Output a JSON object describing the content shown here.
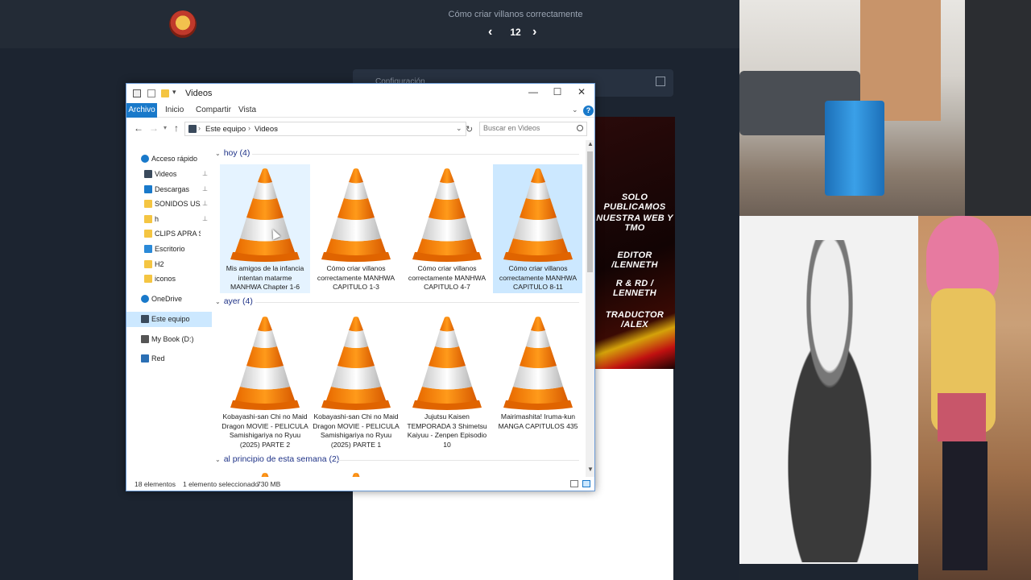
{
  "reader": {
    "chapter_title": "Cómo criar villanos correctamente",
    "chapter_number": "12",
    "prev_icon": "‹",
    "next_icon": "›",
    "config_label": "Configuración",
    "credits": [
      "SOLO PUBLICAMOS",
      "NUESTRA WEB Y TMO",
      "EDITOR /LENNETH",
      "R & RD / LENNETH",
      "TRADUCTOR /ALEX"
    ]
  },
  "explorer": {
    "title": "Videos",
    "ribbon_tabs": [
      "Archivo",
      "Inicio",
      "Compartir",
      "Vista"
    ],
    "address": [
      "Este equipo",
      "Videos"
    ],
    "search_placeholder": "Buscar en Videos",
    "window_controls": {
      "minimize": "—",
      "maximize": "☐",
      "close": "✕"
    },
    "nav_pane": [
      {
        "label": "Acceso rápido",
        "icon": "star-icon",
        "pinned": false
      },
      {
        "label": "Videos",
        "icon": "videos-folder-icon",
        "pinned": true
      },
      {
        "label": "Descargas",
        "icon": "download-icon",
        "pinned": true
      },
      {
        "label": "SONIDOS USAR.",
        "icon": "folder-icon",
        "pinned": true
      },
      {
        "label": "h",
        "icon": "folder-icon",
        "pinned": true
      },
      {
        "label": "CLIPS APRA SUBIR",
        "icon": "folder-icon",
        "pinned": false
      },
      {
        "label": "Escritorio",
        "icon": "desktop-icon",
        "pinned": false
      },
      {
        "label": "H2",
        "icon": "folder-icon",
        "pinned": false
      },
      {
        "label": "iconos",
        "icon": "folder-icon",
        "pinned": false
      },
      {
        "label": "OneDrive",
        "icon": "cloud-icon",
        "pinned": false
      },
      {
        "label": "Este equipo",
        "icon": "pc-icon",
        "pinned": false
      },
      {
        "label": "My Book (D:)",
        "icon": "drive-icon",
        "pinned": false
      },
      {
        "label": "Red",
        "icon": "network-icon",
        "pinned": false
      }
    ],
    "groups": [
      {
        "header": "hoy (4)",
        "files": [
          "Mis amigos de la infancia intentan matarme MANHWA Chapter 1-6",
          "Cómo criar villanos correctamente MANHWA CAPITULO 1-3",
          "Cómo criar villanos correctamente MANHWA CAPITULO 4-7",
          "Cómo criar villanos correctamente MANHWA CAPITULO 8-11"
        ]
      },
      {
        "header": "ayer (4)",
        "files": [
          "Kobayashi-san Chi no Maid Dragon MOVIE - PELICULA Samishigariya no Ryuu (2025) PARTE 2",
          "Kobayashi-san Chi no Maid Dragon MOVIE - PELICULA Samishigariya no Ryuu (2025) PARTE 1",
          "Jujutsu Kaisen TEMPORADA 3 Shimetsu Kaiyuu - Zenpen Episodio 10",
          "Mairimashita! Iruma-kun MANGA CAPITULOS 435"
        ]
      },
      {
        "header": "al principio de esta semana (2)",
        "files": []
      }
    ],
    "status": {
      "count": "18 elementos",
      "selected": "1 elemento seleccionado",
      "size": "730 MB"
    },
    "colors": {
      "accent": "#1979ca",
      "selection": "#cce8ff",
      "group_header": "#1e3287"
    }
  }
}
